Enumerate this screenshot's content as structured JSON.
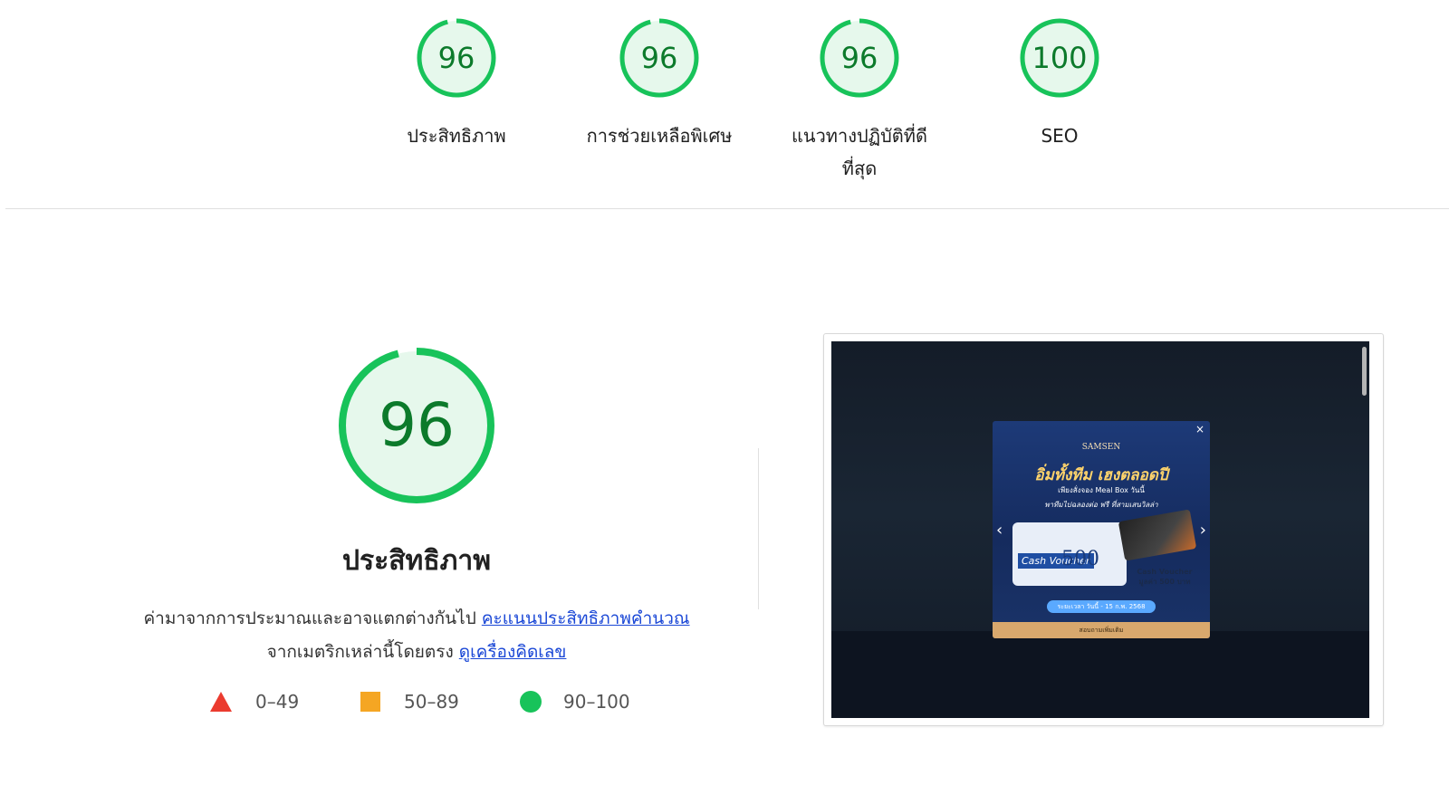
{
  "summary": {
    "gauges": [
      {
        "score": "96",
        "label": "ประสิทธิภาพ",
        "value": 96
      },
      {
        "score": "96",
        "label": "การช่วยเหลือพิเศษ",
        "value": 96
      },
      {
        "score": "96",
        "label_line1": "แนวทางปฏิบัติที่ดี",
        "label_line2": "ที่สุด",
        "value": 96
      },
      {
        "score": "100",
        "label": "SEO",
        "value": 100
      }
    ]
  },
  "performance": {
    "score": "96",
    "value": 96,
    "title": "ประสิทธิภาพ",
    "desc_text1": "ค่ามาจากการประมาณและอาจแตกต่างกันไป ",
    "desc_link1": "คะแนนประสิทธิภาพคำนวณ",
    "desc_text2": "จากเมตริกเหล่านี้โดยตรง ",
    "desc_link2": "ดูเครื่องคิดเลข"
  },
  "legend": {
    "fail": "0–49",
    "average": "50–89",
    "pass": "90–100"
  },
  "screenshot": {
    "brand": "SAMSEN",
    "headline": "อิ่มทั้งทีม เฮงตลอดปี",
    "sub": "เพียงสั่งจอง Meal Box วันนี้",
    "sub2": "พาทีมไปฉลองต่อ ฟรี ที่สามเสนวิลล่า",
    "card_label": "Cash Voucher",
    "card_amount": "500",
    "voucher_text": "Cash Voucher มูลค่า 500 บาท",
    "pill": "ระยะเวลา วันนี้ - 15 ก.พ. 2568",
    "strip": "สอบถามเพิ่มเติม",
    "close": "×",
    "arrow_left": "‹",
    "arrow_right": "›"
  },
  "colors": {
    "pass": "#0c7a2b",
    "pass_ring": "#18c35a",
    "pass_fill": "#e6f8ec",
    "fail": "#eb3b2f",
    "average": "#f5a623",
    "link": "#1a47d6"
  }
}
